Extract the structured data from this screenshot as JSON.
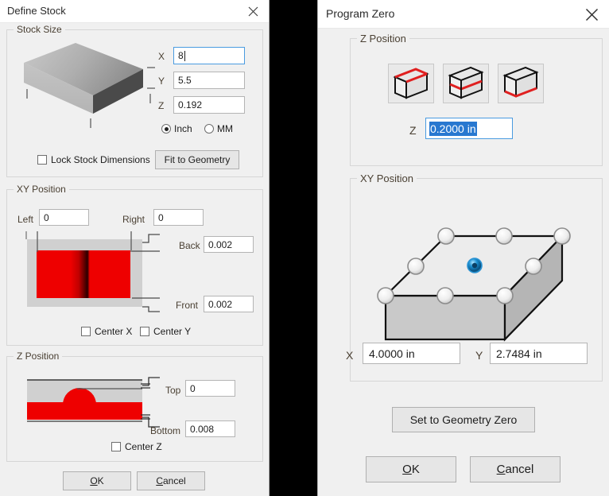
{
  "define_stock": {
    "title": "Define Stock",
    "close_icon": "close-icon",
    "stock_size": {
      "legend": "Stock Size",
      "fields": [
        {
          "label": "X",
          "value": "8",
          "focused": true
        },
        {
          "label": "Y",
          "value": "5.5",
          "focused": false
        },
        {
          "label": "Z",
          "value": "0.192",
          "focused": false
        }
      ],
      "units": [
        {
          "label": "Inch",
          "selected": true
        },
        {
          "label": "MM",
          "selected": false
        }
      ],
      "lock_checkbox": {
        "label": "Lock Stock Dimensions",
        "checked": false
      },
      "fit_button": "Fit to Geometry"
    },
    "xy_position": {
      "legend": "XY Position",
      "left": {
        "label": "Left",
        "value": "0"
      },
      "right": {
        "label": "Right",
        "value": "0"
      },
      "back": {
        "label": "Back",
        "value": "0.002"
      },
      "front": {
        "label": "Front",
        "value": "0.002"
      },
      "center_x": {
        "label": "Center X",
        "checked": false
      },
      "center_y": {
        "label": "Center Y",
        "checked": false
      }
    },
    "z_position": {
      "legend": "Z Position",
      "top": {
        "label": "Top",
        "value": "0"
      },
      "bottom": {
        "label": "Bottom",
        "value": "0.008"
      },
      "center_z": {
        "label": "Center Z",
        "checked": false
      }
    },
    "ok_label": "OK",
    "ok_mnemonic": "O",
    "cancel_label": "Cancel",
    "cancel_mnemonic": "C"
  },
  "program_zero": {
    "title": "Program Zero",
    "close_icon": "close-icon",
    "z_position": {
      "legend": "Z Position",
      "cube_buttons": [
        {
          "name": "z-top-button",
          "highlight": "top",
          "selected": false
        },
        {
          "name": "z-middle-button",
          "highlight": "middle",
          "selected": false
        },
        {
          "name": "z-bottom-button",
          "highlight": "bottom",
          "selected": false
        }
      ],
      "z_field": {
        "label": "Z",
        "value": "0.2000 in",
        "selected": true,
        "focused": true
      }
    },
    "xy_position": {
      "legend": "XY Position",
      "x_field": {
        "label": "X",
        "value": "4.0000 in"
      },
      "y_field": {
        "label": "Y",
        "value": "2.7484 in"
      },
      "handles": [
        {
          "name": "handle-back-left",
          "active": false
        },
        {
          "name": "handle-back-center",
          "active": false
        },
        {
          "name": "handle-back-right",
          "active": false
        },
        {
          "name": "handle-mid-left",
          "active": false
        },
        {
          "name": "handle-center",
          "active": true
        },
        {
          "name": "handle-mid-right",
          "active": false
        },
        {
          "name": "handle-front-left",
          "active": false
        },
        {
          "name": "handle-front-center",
          "active": false
        },
        {
          "name": "handle-front-right",
          "active": false
        }
      ]
    },
    "set_geometry_zero_label": "Set to Geometry Zero",
    "ok_label": "OK",
    "ok_mnemonic": "O",
    "cancel_label": "Cancel",
    "cancel_mnemonic": "C"
  },
  "colors": {
    "dialog_bg": "#f0f0f0",
    "titlebar_bg": "#ffffff",
    "accent_focus": "#4a9be0",
    "selection_blue": "#2878d0",
    "stock_red": "#ee0000",
    "label_brown": "#4a4033",
    "handle_active": "#1b8fd0",
    "backdrop": "#000000"
  }
}
